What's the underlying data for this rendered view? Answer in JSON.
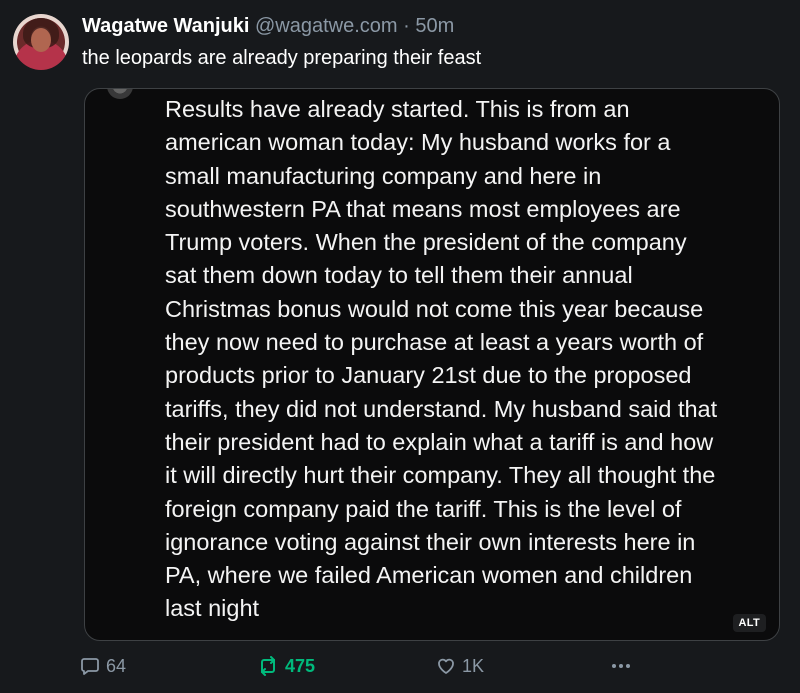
{
  "post": {
    "author": {
      "display_name": "Wagatwe Wanjuki",
      "handle": "@wagatwe.com",
      "separator": "·",
      "time": "50m"
    },
    "text": "the leopards are already preparing their feast",
    "media": {
      "quoted_text": "Results have already started.  This is from an\namerican woman today: My husband works for a\nsmall manufacturing company and here in\nsouthwestern PA that means most employees are\nTrump voters. When the president of the company\nsat them down today to tell them their annual\nChristmas bonus would not come this year because\nthey now need to purchase at least a years worth of\nproducts prior to January 21st due to the proposed\ntariffs, they did not understand. My husband said that\ntheir president had to explain what a tariff is and how\nit will directly hurt their company. They all thought the\nforeign company paid the tariff. This is the level of\nignorance voting against their own interests here in\nPA, where we failed American women and children\nlast night",
      "alt_label": "ALT"
    },
    "actions": {
      "reply_icon": "speech-bubble-icon",
      "reply_count": "64",
      "repost_icon": "repost-arrows-icon",
      "repost_count": "475",
      "repost_color": "#00ba7c",
      "like_icon": "heart-icon",
      "like_count": "1K",
      "more_icon": "ellipsis-icon"
    }
  }
}
